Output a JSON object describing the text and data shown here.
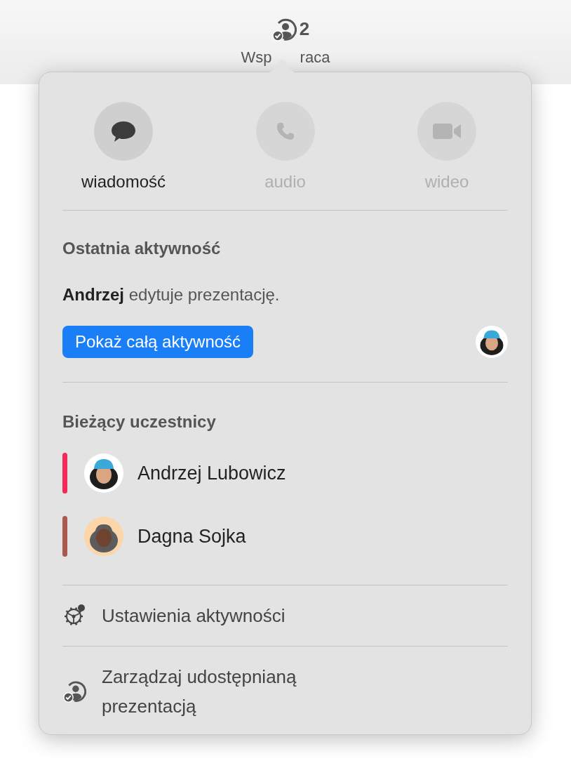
{
  "toolbar": {
    "count": "2",
    "label_start": "Wsp",
    "label_end": "raca"
  },
  "actions": [
    {
      "kind": "message",
      "label": "wiadomość",
      "disabled": false
    },
    {
      "kind": "audio",
      "label": "audio",
      "disabled": true
    },
    {
      "kind": "video",
      "label": "wideo",
      "disabled": true
    }
  ],
  "recent_activity": {
    "heading": "Ostatnia aktywność",
    "entry": "**Andrzej** edytuje prezentację.",
    "button": "Pokaż całą aktywność"
  },
  "participants": {
    "heading": "Bieżący uczestnicy",
    "items": [
      {
        "name": "Andrzej Lubowicz",
        "color": "#f5285a",
        "kind": "light"
      },
      {
        "name": "Dagna Sojka",
        "color": "#a85a4e",
        "kind": "dark"
      }
    ]
  },
  "menu": [
    {
      "kind": "settings",
      "label": "Ustawienia aktywności"
    },
    {
      "kind": "manage",
      "label": "Zarządzaj udostępnianą prezentacją"
    }
  ]
}
